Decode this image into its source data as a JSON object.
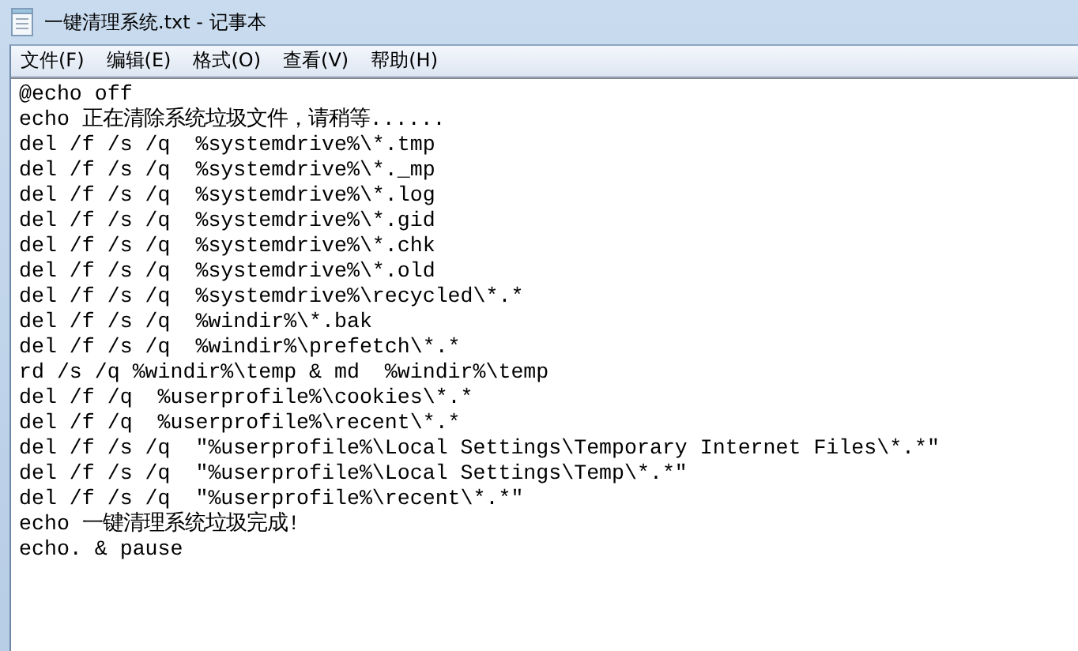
{
  "window": {
    "title": "一键清理系统.txt - 记事本"
  },
  "menu": [
    "文件(F)",
    "编辑(E)",
    "格式(O)",
    "查看(V)",
    "帮助(H)"
  ],
  "document": {
    "lines": [
      "@echo off",
      "echo 正在清除系统垃圾文件，请稍等......",
      "del /f /s /q  %systemdrive%\\*.tmp",
      "del /f /s /q  %systemdrive%\\*._mp",
      "del /f /s /q  %systemdrive%\\*.log",
      "del /f /s /q  %systemdrive%\\*.gid",
      "del /f /s /q  %systemdrive%\\*.chk",
      "del /f /s /q  %systemdrive%\\*.old",
      "del /f /s /q  %systemdrive%\\recycled\\*.*",
      "del /f /s /q  %windir%\\*.bak",
      "del /f /s /q  %windir%\\prefetch\\*.*",
      "rd /s /q %windir%\\temp & md  %windir%\\temp",
      "del /f /q  %userprofile%\\cookies\\*.*",
      "del /f /q  %userprofile%\\recent\\*.*",
      "del /f /s /q  \"%userprofile%\\Local Settings\\Temporary Internet Files\\*.*\"",
      "del /f /s /q  \"%userprofile%\\Local Settings\\Temp\\*.*\"",
      "del /f /s /q  \"%userprofile%\\recent\\*.*\"",
      "echo 一键清理系统垃圾完成!",
      "echo. & pause"
    ]
  }
}
